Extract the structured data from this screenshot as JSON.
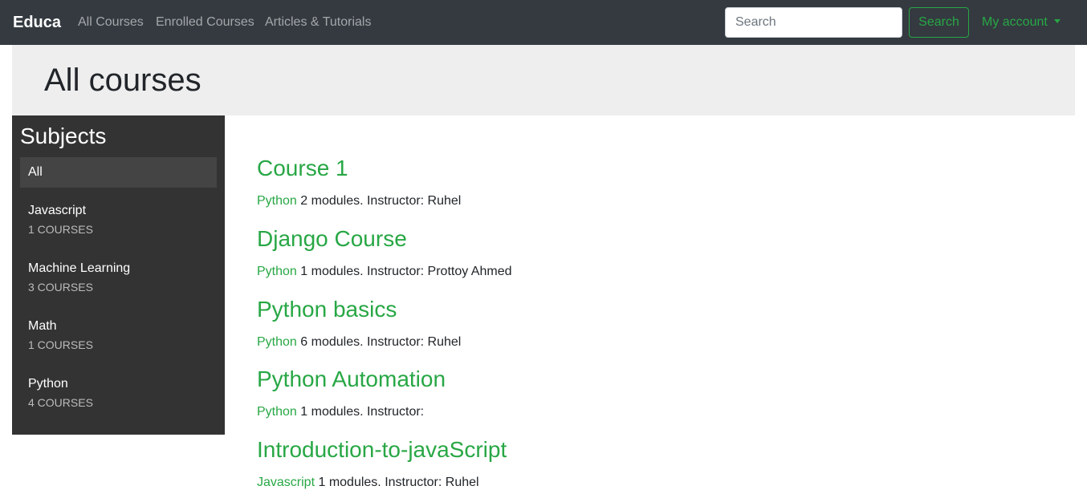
{
  "navbar": {
    "brand": "Educa",
    "links": [
      "All Courses",
      "Enrolled Courses",
      "Articles & Tutorials"
    ],
    "search_placeholder": "Search",
    "search_button": "Search",
    "account": "My account"
  },
  "header": {
    "title": "All courses"
  },
  "sidebar": {
    "title": "Subjects",
    "items": [
      {
        "name": "All",
        "count": ""
      },
      {
        "name": "Javascript",
        "count": "1 COURSES"
      },
      {
        "name": "Machine Learning",
        "count": "3 COURSES"
      },
      {
        "name": "Math",
        "count": "1 COURSES"
      },
      {
        "name": "Python",
        "count": "4 COURSES"
      }
    ]
  },
  "courses": [
    {
      "title": "Course 1",
      "subject": "Python",
      "meta": "2 modules. Instructor: Ruhel"
    },
    {
      "title": "Django Course",
      "subject": "Python",
      "meta": "1 modules. Instructor: Prottoy Ahmed"
    },
    {
      "title": "Python basics",
      "subject": "Python",
      "meta": "6 modules. Instructor: Ruhel"
    },
    {
      "title": "Python Automation",
      "subject": "Python",
      "meta": "1 modules. Instructor:"
    },
    {
      "title": "Introduction-to-javaScript",
      "subject": "Javascript",
      "meta": "1 modules. Instructor: Ruhel"
    }
  ],
  "colors": {
    "navbar": "#343a40",
    "accent": "#28a745",
    "sidebar": "#333333",
    "header": "#eeeeee"
  }
}
